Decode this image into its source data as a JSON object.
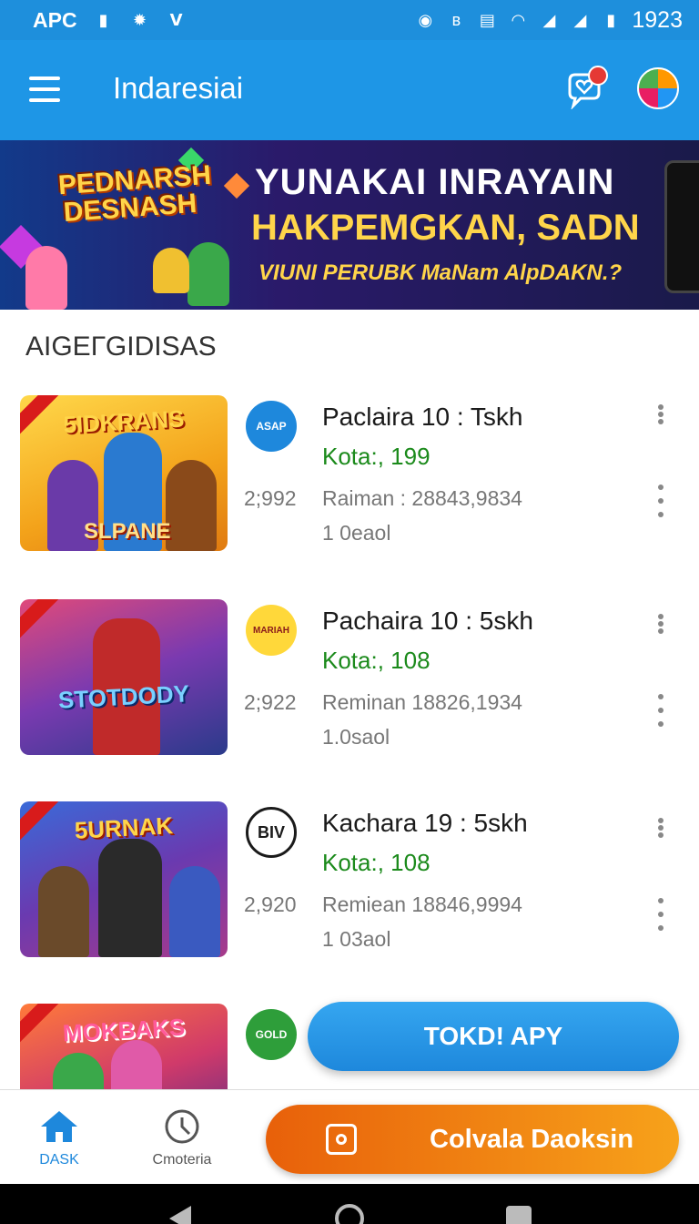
{
  "status_bar": {
    "carrier": "APC",
    "time": "1923",
    "left_icons": [
      "sim-icon",
      "settings-icon",
      "signal-wave-icon"
    ],
    "right_icons": [
      "alarm-icon",
      "bluetooth-icon",
      "nfc-icon",
      "wifi-icon",
      "cell-signal-icon",
      "battery-icon"
    ]
  },
  "app_bar": {
    "title": "Indaresiai",
    "menu_icon": "hamburger-icon",
    "notification_icon": "chat-heart-icon",
    "avatar_icon": "color-wheel-avatar"
  },
  "banner": {
    "logo_text": "PEDNARSH DESNASH",
    "headline_1": "YUNAKAI INRAYAIN",
    "headline_2": "HAKPEMGKAN, SADN",
    "subline": "VIUNI PERUBK MaNam AlpDAKN.?"
  },
  "section": {
    "title": "AIGEГGIDISAS"
  },
  "items": [
    {
      "thumb_title": "5IDKRANS",
      "thumb_subtitle": "SLPANE",
      "icon_text": "ASAP",
      "icon_color": "#1e88dc",
      "title": "Paclaira 10 : Tskh",
      "price": "Kota:, 199",
      "count": "2;992",
      "meta": "Raiman : 28843,9834",
      "sub": "1 0eaol"
    },
    {
      "thumb_title": "STOTDODY",
      "thumb_subtitle": "",
      "icon_text": "MARIAH",
      "icon_color": "#ffd83a",
      "title": "Pachaira 10 : 5skh",
      "price": "Kota:, 108",
      "count": "2;922",
      "meta": "Reminan 18826,1934",
      "sub": "1.0saol"
    },
    {
      "thumb_title": "5URNAK",
      "thumb_subtitle": "",
      "icon_text": "BIV",
      "icon_color": "#1a1a1a",
      "title": "Kachara 19 : 5skh",
      "price": "Kota:, 108",
      "count": "2,920",
      "meta": "Remiean 18846,9994",
      "sub": "1 03aol"
    },
    {
      "thumb_title": "MOKBAKS",
      "thumb_subtitle": "",
      "icon_text": "GOLD",
      "icon_color": "#2e9e3a",
      "title": "",
      "price": "",
      "count": "",
      "meta": "",
      "sub": ""
    }
  ],
  "fab": {
    "label": "TOKD! APY"
  },
  "bottom_nav": {
    "home_label": "DASK",
    "history_label": "Cmoteria",
    "cta_label": "Colvala Daoksin",
    "accent_color": "#1e88dc",
    "cta_color": "#f08a12"
  }
}
